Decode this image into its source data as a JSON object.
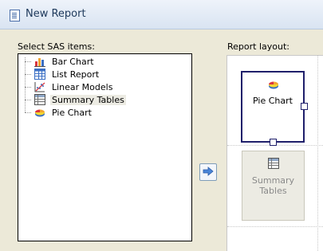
{
  "window": {
    "title": "New Report"
  },
  "left_panel": {
    "label": "Select SAS items:",
    "items": [
      {
        "label": "Bar Chart",
        "icon": "bar-chart-icon",
        "selected": false
      },
      {
        "label": "List Report",
        "icon": "list-report-icon",
        "selected": false
      },
      {
        "label": "Linear Models",
        "icon": "linear-models-icon",
        "selected": false
      },
      {
        "label": "Summary Tables",
        "icon": "summary-tables-icon",
        "selected": true
      },
      {
        "label": "Pie Chart",
        "icon": "pie-chart-icon",
        "selected": false
      }
    ]
  },
  "add_button": {
    "icon": "arrow-right-icon"
  },
  "right_panel": {
    "label": "Report layout:",
    "cells": [
      {
        "label": "Pie Chart",
        "icon": "pie-chart-icon",
        "state": "selected"
      },
      {
        "label": "Summary\nTables",
        "icon": "summary-tables-icon",
        "state": "disabled"
      }
    ]
  },
  "colors": {
    "title_text": "#1e395b",
    "selection_border": "#1f1f6b",
    "dialog_bg": "#ece9d8"
  }
}
